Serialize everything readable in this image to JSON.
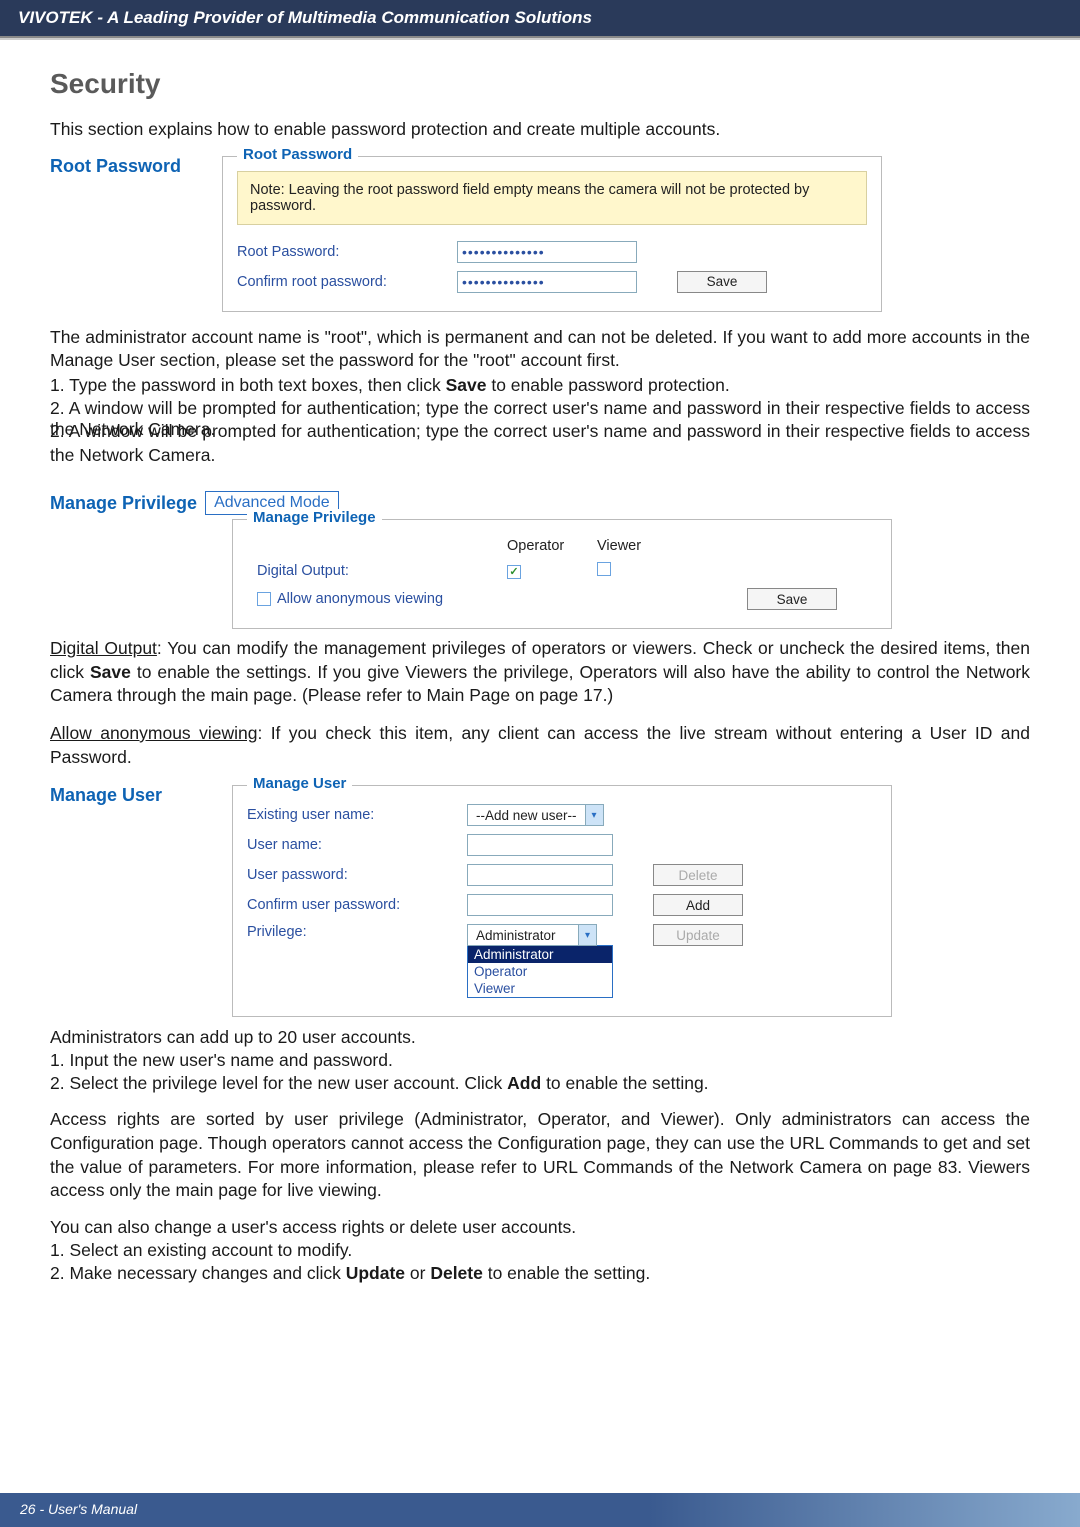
{
  "header": {
    "title": "VIVOTEK - A Leading Provider of Multimedia Communication Solutions"
  },
  "h2": "Security",
  "intro": "This section explains how to enable password protection and create multiple accounts.",
  "root_pw": {
    "heading": "Root Password",
    "legend": "Root Password",
    "note": "Note: Leaving the root password field empty means the camera will not be protected by password.",
    "label1": "Root Password:",
    "label2": "Confirm root password:",
    "mask": "••••••••••••••",
    "save": "Save"
  },
  "para_admin": {
    "p1": "The administrator account name is \"root\", which is permanent and can not be deleted. If you want to add more accounts in the Manage User section, please set the password for the \"root\" account first.",
    "l1_a": "1. Type the password in both text boxes, then click ",
    "l1_b": "Save",
    "l1_c": " to enable password protection.",
    "l2": "2. A window will be prompted for authentication; type the correct user's name and password in their respective fields to access the Network Camera."
  },
  "priv": {
    "heading": "Manage Privilege",
    "badge": "Advanced Mode",
    "legend": "Manage Privilege",
    "col_op": "Operator",
    "col_vw": "Viewer",
    "row_digital": "Digital Output:",
    "row_anon": "Allow anonymous viewing",
    "save": "Save"
  },
  "para_priv": {
    "p1_a": "Digital Output",
    "p1_b": ": You can modify the management privileges of operators or viewers. Check or uncheck the desired items, then click ",
    "p1_c": "Save",
    "p1_d": " to enable the settings. If you give Viewers the privilege, Operators will also have the ability to control the Network Camera through the main page. (Please refer to Main Page on page 17.)",
    "p2_a": "Allow anonymous viewing",
    "p2_b": ": If you check this item, any client can access the live stream without entering a User ID and Password."
  },
  "manage_user": {
    "heading": "Manage User",
    "legend": "Manage User",
    "existing": "Existing user name:",
    "username": "User name:",
    "userpw": "User password:",
    "confirm": "Confirm user password:",
    "privilege": "Privilege:",
    "sel_existing": "--Add new user--",
    "sel_priv": "Administrator",
    "opt1": "Administrator",
    "opt2": "Operator",
    "opt3": "Viewer",
    "btn_delete": "Delete",
    "btn_add": "Add",
    "btn_update": "Update"
  },
  "para_mu": {
    "l0": "Administrators can add up to 20 user accounts.",
    "l1": "1. Input the new user's name and password.",
    "l2_a": "2. Select the privilege level for the new user account. Click ",
    "l2_b": "Add",
    "l2_c": " to enable the setting.",
    "p3": "Access rights are sorted by user privilege (Administrator, Operator, and Viewer). Only administrators can access the Configuration page. Though operators cannot access the Configuration page, they can use the URL Commands to get and set the value of parameters. For more information, please refer to URL Commands of the Network Camera on page 83. Viewers access only the main page for live viewing.",
    "p4": "You can also change a user's access rights or delete user accounts.",
    "l5": "1. Select an existing account to modify.",
    "l6_a": "2. Make necessary changes and click ",
    "l6_b": "Update",
    "l6_c": " or ",
    "l6_d": "Delete",
    "l6_e": " to enable the setting."
  },
  "footer": "26 - User's Manual"
}
